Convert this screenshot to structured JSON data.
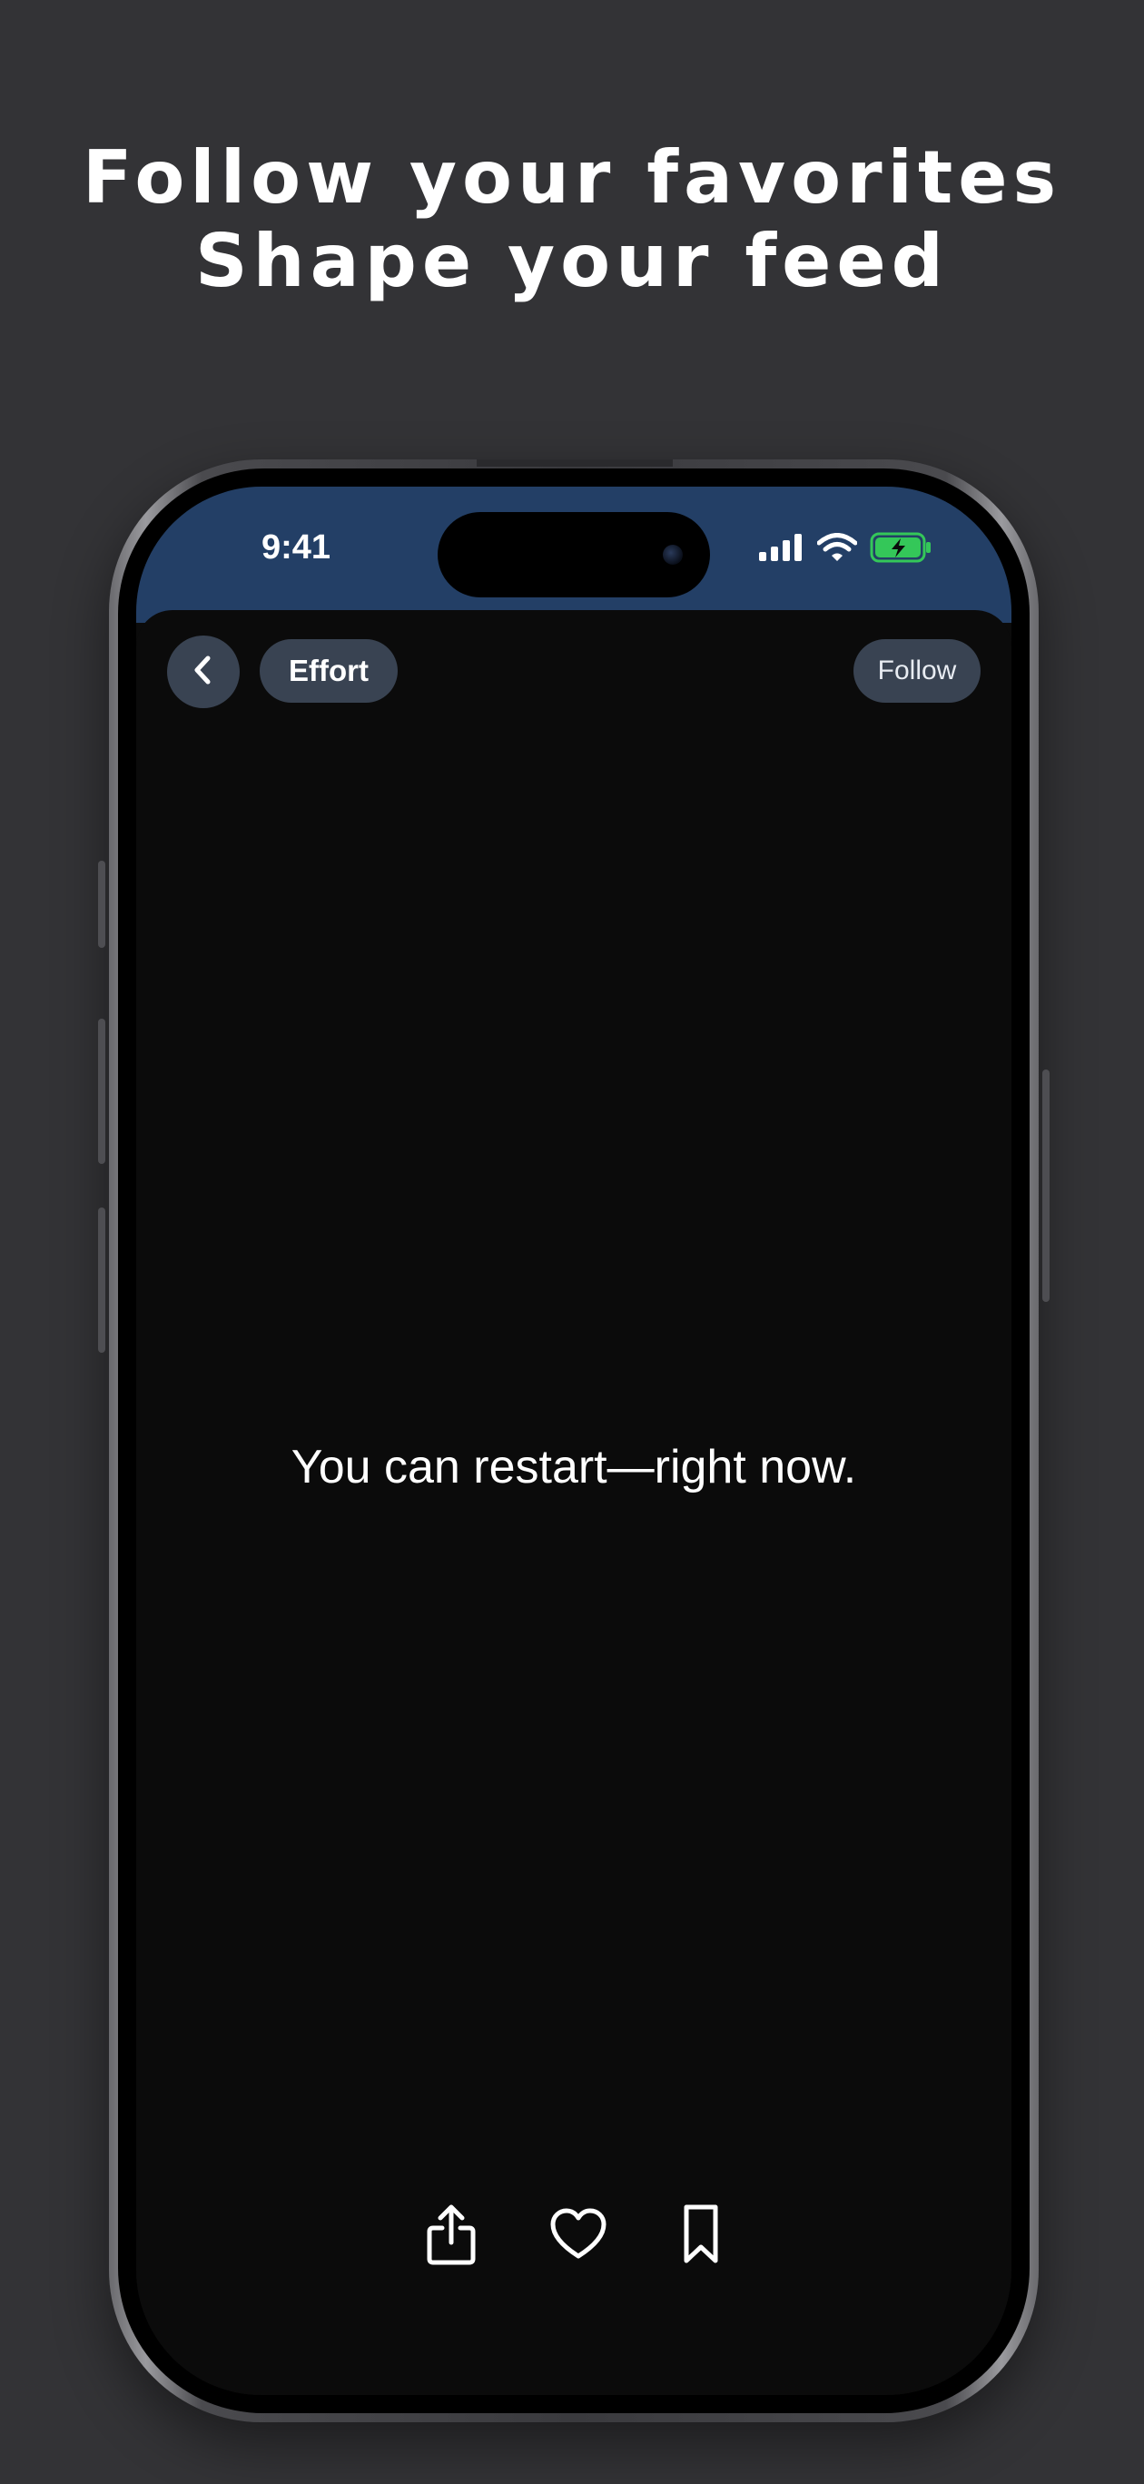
{
  "marketing": {
    "line1": "Follow your favorites",
    "line2": "Shape your feed"
  },
  "status_bar": {
    "time": "9:41",
    "icons": [
      "signal-bars-icon",
      "wifi-icon",
      "battery-charging-icon"
    ],
    "battery_color": "#34c759"
  },
  "header": {
    "back_icon": "chevron-left-icon",
    "topic_label": "Effort",
    "follow_label": "Follow"
  },
  "card": {
    "quote": "You can restart—right now."
  },
  "actions": [
    {
      "icon": "share-icon"
    },
    {
      "icon": "heart-icon"
    },
    {
      "icon": "bookmark-icon"
    }
  ],
  "colors": {
    "page_background": "#333336",
    "status_background": "#233f66",
    "screen_background": "#0b0b0b",
    "pill_background": "#394352"
  }
}
